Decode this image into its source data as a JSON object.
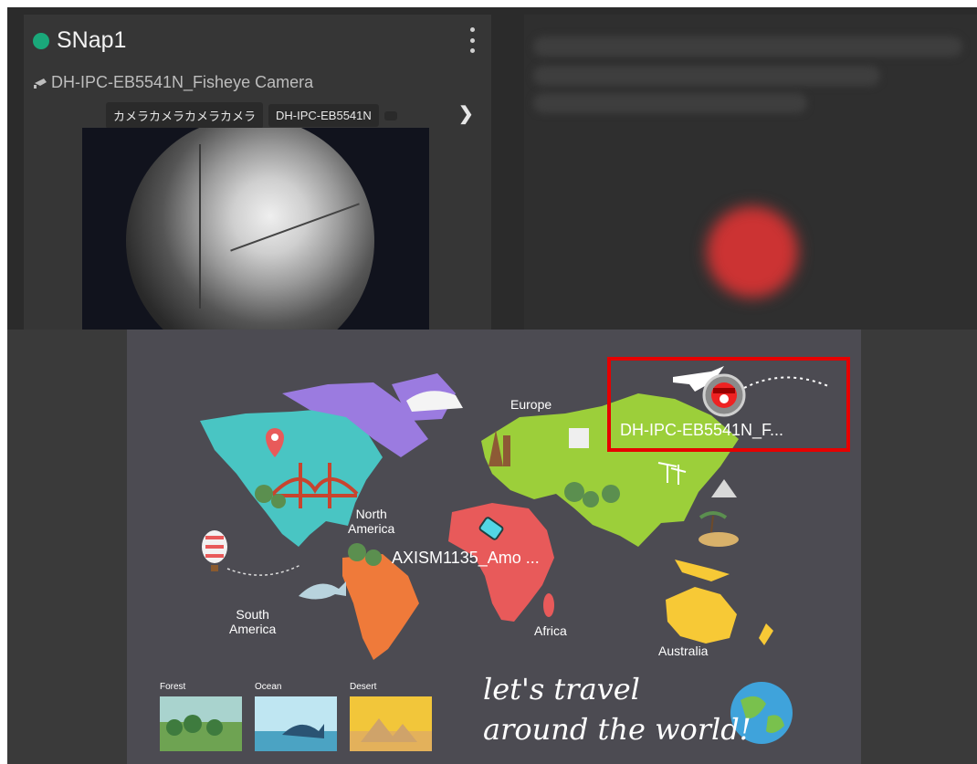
{
  "snapshot_card": {
    "status_color": "#1aa87a",
    "title": "SNap1",
    "camera_name": "DH-IPC-EB5541N_Fisheye Camera",
    "tags": [
      "カメラカメラカメラカメラ",
      "DH-IPC-EB5541N",
      ""
    ],
    "more_icon": "kebab-icon",
    "next_icon": "chevron-right-icon"
  },
  "map": {
    "continents": {
      "europe": "Europe",
      "north_america": "North\nAmerica",
      "south_america": "South\nAmerica",
      "africa": "Africa",
      "australia": "Australia"
    },
    "devices": [
      {
        "label": "DH-IPC-EB5541N_F...",
        "icon": "dome-camera-icon",
        "highlight_color": "#e60000"
      },
      {
        "label": "AXISM1135_Amo ...",
        "icon": "bullet-camera-icon"
      }
    ],
    "thumbnails": [
      {
        "caption": "Forest"
      },
      {
        "caption": "Ocean"
      },
      {
        "caption": "Desert"
      }
    ],
    "slogan_line1": "let's travel",
    "slogan_line2": "around the world!"
  }
}
